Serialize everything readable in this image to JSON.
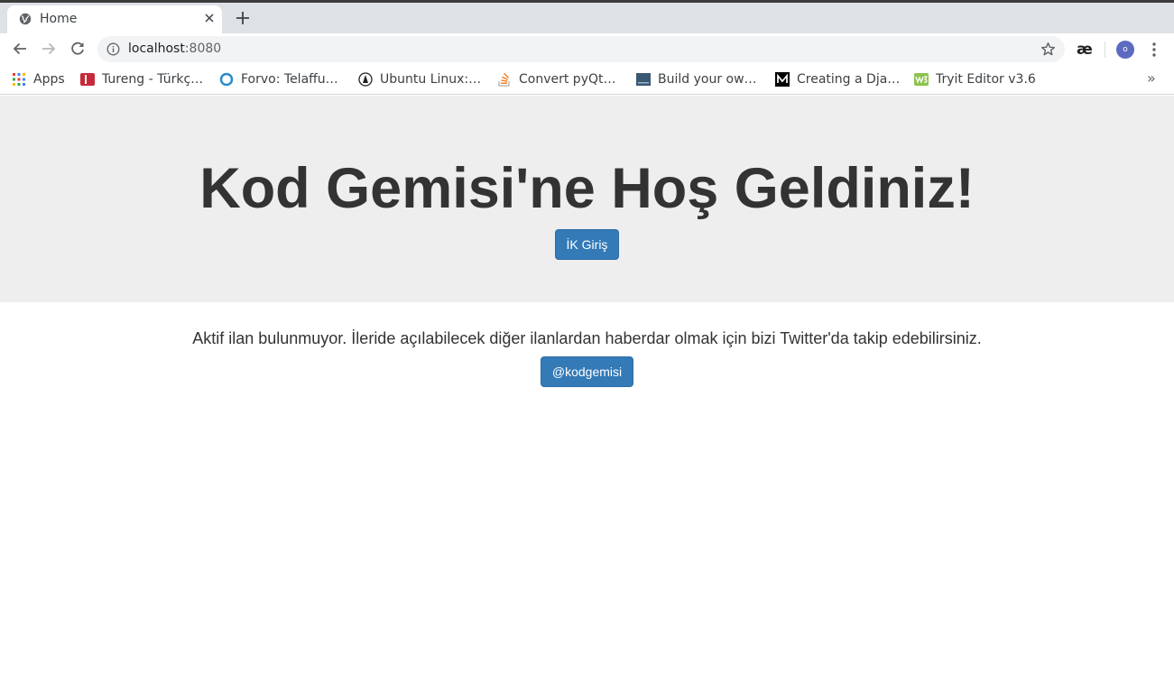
{
  "browser": {
    "tab": {
      "title": "Home",
      "favicon": "globe-icon"
    },
    "address": {
      "host": "localhost",
      "port": ":8080"
    },
    "extension_label": "æ",
    "profile_initial": "o",
    "bookmarks": [
      {
        "label": "Apps",
        "icon": "apps-grid-icon"
      },
      {
        "label": "Tureng - Türkç…",
        "icon": "tureng-icon"
      },
      {
        "label": "Forvo: Telaffu…",
        "icon": "forvo-icon"
      },
      {
        "label": "Ubuntu Linux:…",
        "icon": "ubuntu-icon"
      },
      {
        "label": "Convert pyQt…",
        "icon": "stackoverflow-icon"
      },
      {
        "label": "Build your ow…",
        "icon": "build-icon"
      },
      {
        "label": "Creating a Dja…",
        "icon": "medium-icon"
      },
      {
        "label": "Tryit Editor v3.6",
        "icon": "w3schools-icon"
      }
    ],
    "bookmarks_overflow": "»"
  },
  "page": {
    "headline": "Kod Gemisi'ne Hoş Geldiniz!",
    "login_button": "İK Giriş",
    "notice": "Aktif ilan bulunmuyor. İleride açılabilecek diğer ilanlardan haberdar olmak için bizi Twitter'da takip edebilirsiniz.",
    "twitter_button": "@kodgemisi"
  },
  "colors": {
    "button": "#337ab7",
    "jumbotron_bg": "#eeeeee",
    "text": "#333333"
  }
}
